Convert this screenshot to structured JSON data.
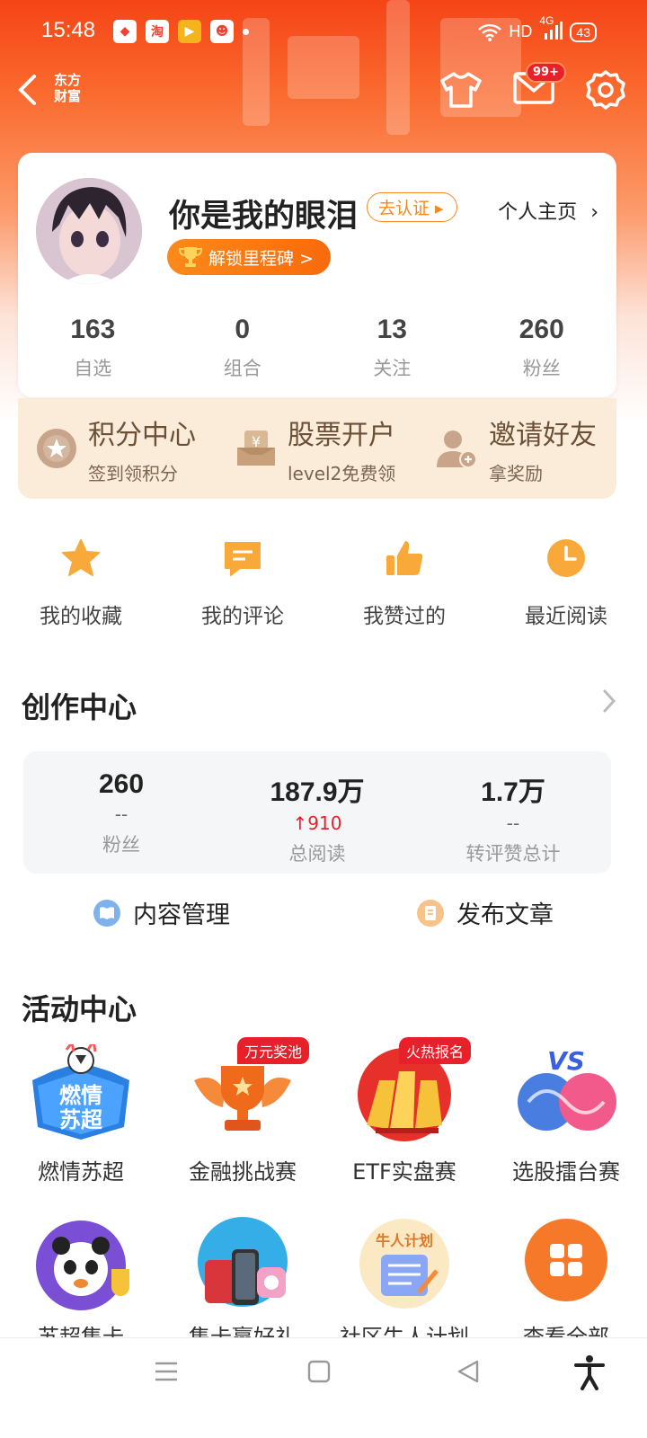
{
  "status": {
    "time": "15:48",
    "network": "HD",
    "signal": "4G",
    "battery": "43",
    "app_icons": [
      "red-app-icon",
      "taobao-icon",
      "video-app-icon",
      "game-app-icon"
    ]
  },
  "nav": {
    "brand_line1": "东方",
    "brand_line2": "财富",
    "mail_badge": "99+"
  },
  "profile": {
    "name": "你是我的眼泪",
    "verify": "去认证 ▸",
    "homepage": "个人主页",
    "milestone": "解锁里程碑 >",
    "stats": [
      {
        "num": "163",
        "label": "自选"
      },
      {
        "num": "0",
        "label": "组合"
      },
      {
        "num": "13",
        "label": "关注"
      },
      {
        "num": "260",
        "label": "粉丝"
      }
    ]
  },
  "promo": [
    {
      "title": "积分中心",
      "sub": "签到领积分"
    },
    {
      "title": "股票开户",
      "sub": "level2免费领"
    },
    {
      "title": "邀请好友",
      "sub": "拿奖励"
    }
  ],
  "quick": [
    {
      "label": "我的收藏"
    },
    {
      "label": "我的评论"
    },
    {
      "label": "我赞过的"
    },
    {
      "label": "最近阅读"
    }
  ],
  "creation": {
    "title": "创作中心",
    "stats": [
      {
        "num": "260",
        "delta": "--",
        "label": "粉丝"
      },
      {
        "num": "187.9万",
        "delta": "↑910",
        "label": "总阅读"
      },
      {
        "num": "1.7万",
        "delta": "--",
        "label": "转评赞总计"
      }
    ],
    "actions": [
      "内容管理",
      "发布文章"
    ]
  },
  "activity": {
    "title": "活动中心",
    "row1": [
      {
        "label": "燃情苏超",
        "tag": ""
      },
      {
        "label": "金融挑战赛",
        "tag": "万元奖池"
      },
      {
        "label": "ETF实盘赛",
        "tag": "火热报名"
      },
      {
        "label": "选股擂台赛",
        "tag": ""
      }
    ],
    "row2": [
      {
        "label": "苏超集卡"
      },
      {
        "label": "集卡赢好礼"
      },
      {
        "label": "社区牛人计划"
      },
      {
        "label": "查看全部"
      }
    ],
    "art_text": {
      "suchao_art": "燃情苏超",
      "vs_art": "VS",
      "niuren_art": "牛人计划"
    }
  },
  "colors": {
    "accent": "#f54416",
    "orange": "#f98a1a",
    "up": "#e8202a"
  }
}
